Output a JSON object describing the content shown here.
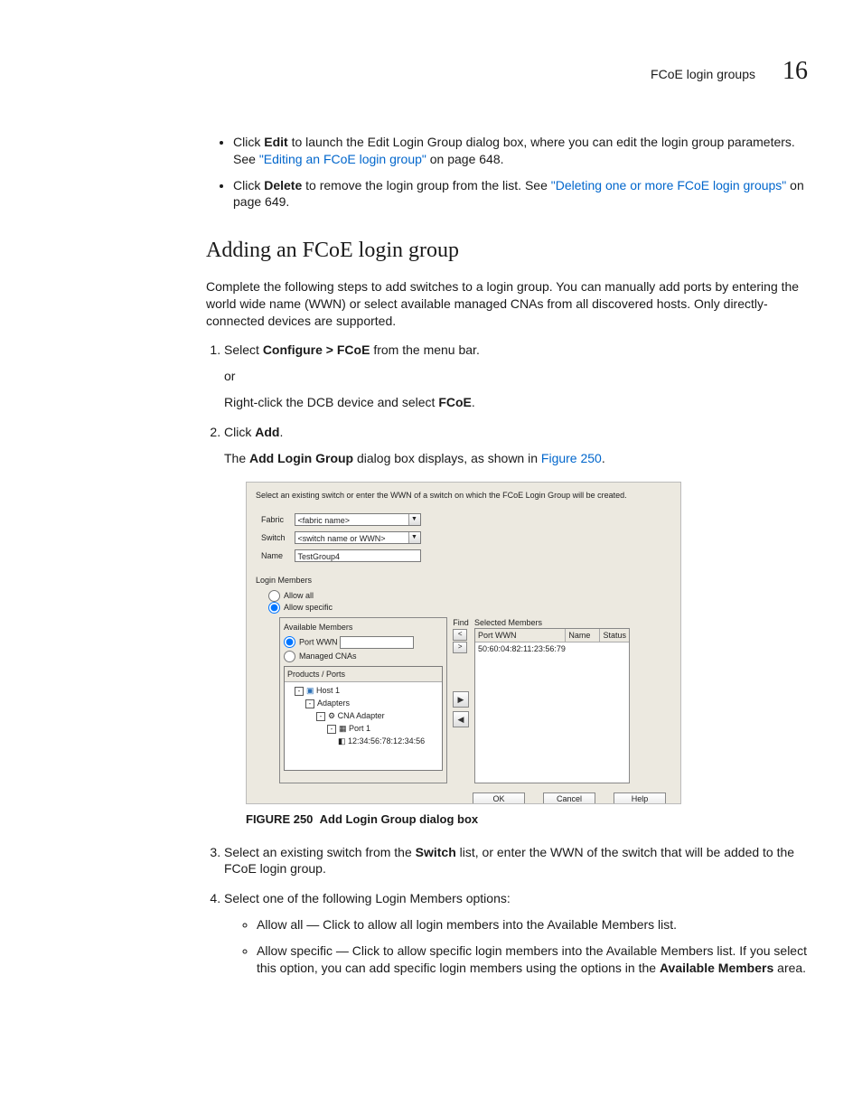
{
  "header": {
    "section": "FCoE login groups",
    "chapter": "16"
  },
  "bullets": [
    {
      "pre": "Click ",
      "bold1": "Edit",
      "mid": " to launch the Edit Login Group dialog box, where you can edit the login group parameters. See ",
      "link": "\"Editing an FCoE login group\"",
      "post": " on page 648."
    },
    {
      "pre": "Click ",
      "bold1": "Delete",
      "mid": " to remove the login group from the list. See ",
      "link": "\"Deleting one or more FCoE login groups\"",
      "post": " on page 649."
    }
  ],
  "heading": "Adding an FCoE login group",
  "intro": "Complete the following steps to add switches to a login group. You can manually add ports by entering the world wide name (WWN) or select available managed CNAs from all discovered hosts. Only directly-connected devices are supported.",
  "steps": {
    "s1": {
      "pre": "Select ",
      "bold": "Configure > FCoE",
      "post": " from the menu bar.",
      "sub1": "or",
      "sub2_pre": "Right-click the DCB device and select ",
      "sub2_bold": "FCoE",
      "sub2_post": "."
    },
    "s2": {
      "pre": "Click ",
      "bold": "Add",
      "post": ".",
      "sub_pre": "The ",
      "sub_bold": "Add Login Group",
      "sub_mid": " dialog box displays, as shown in ",
      "sub_link": "Figure 250",
      "sub_post": "."
    },
    "s3": {
      "pre": "Select an existing switch from the ",
      "bold": "Switch",
      "post": " list, or enter the WWN of the switch that will be added to the FCoE login group."
    },
    "s4": {
      "text": "Select one of the following Login Members options:",
      "opt1": "Allow all — Click to allow all login members into the Available Members list.",
      "opt2_pre": "Allow specific — Click to allow specific login members into the Available Members list. If you select this option, you can add specific login members using the options in the ",
      "opt2_bold": "Available Members",
      "opt2_post": " area."
    }
  },
  "figure": {
    "label": "FIGURE 250",
    "caption": "Add Login Group dialog box"
  },
  "dialog": {
    "instr": "Select an existing switch or enter the WWN of a switch on which the FCoE Login Group will be created.",
    "labels": {
      "fabric": "Fabric",
      "switch": "Switch",
      "name": "Name",
      "login_members": "Login Members",
      "allow_all": "Allow all",
      "allow_specific": "Allow specific",
      "avail": "Available Members",
      "port_wwn": "Port WWN",
      "managed_cnas": "Managed CNAs",
      "find": "Find",
      "sel": "Selected Members"
    },
    "values": {
      "fabric": "<fabric name>",
      "switch": "<switch name or WWN>",
      "name": "TestGroup4"
    },
    "tree": {
      "header": "Products / Ports",
      "host": "Host 1",
      "adapters": "Adapters",
      "cna": "CNA Adapter",
      "port": "Port 1",
      "wwn": "12:34:56:78:12:34:56"
    },
    "selcols": {
      "c1": "Port WWN",
      "c2": "Name",
      "c3": "Status"
    },
    "selrow": "50:60:04:82:11:23:56:79",
    "buttons": {
      "ok": "OK",
      "cancel": "Cancel",
      "help": "Help"
    },
    "arrows": {
      "lt": "<",
      "gt": ">"
    }
  }
}
